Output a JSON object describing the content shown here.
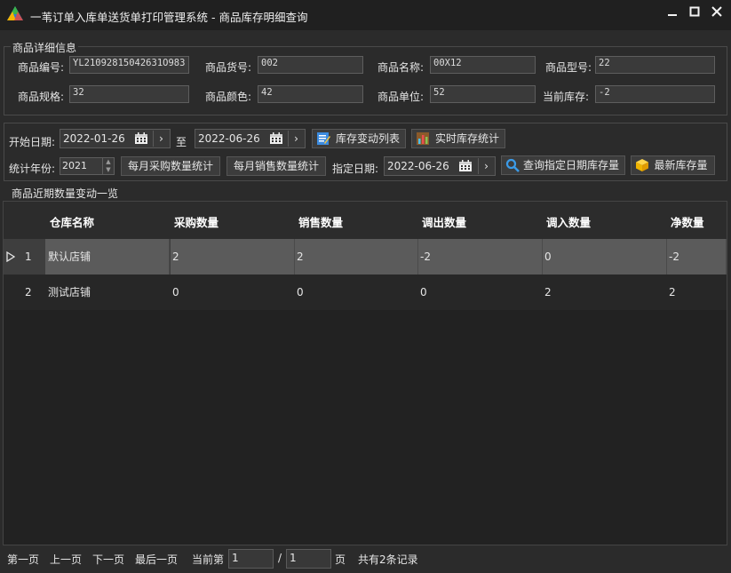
{
  "window": {
    "title": "一苇订单入库单送货单打印管理系统 - 商品库存明细查询"
  },
  "detail": {
    "group_title": "商品详细信息",
    "fields": [
      {
        "label": "商品编号:",
        "value": "YL21092815042631O983"
      },
      {
        "label": "商品货号:",
        "value": "002"
      },
      {
        "label": "商品名称:",
        "value": "00X12"
      },
      {
        "label": "商品型号:",
        "value": "22"
      },
      {
        "label": "商品规格:",
        "value": "32"
      },
      {
        "label": "商品颜色:",
        "value": "42"
      },
      {
        "label": "商品单位:",
        "value": "52"
      },
      {
        "label": "当前库存:",
        "value": "-2"
      }
    ]
  },
  "query": {
    "start_label": "开始日期:",
    "start_date": "2022-01-26",
    "to_label": "至",
    "end_date": "2022-06-26",
    "btn_change_list": "库存变动列表",
    "btn_realtime": "实时库存统计",
    "year_label": "统计年份:",
    "year_value": "2021",
    "btn_monthly_purchase": "每月采购数量统计",
    "btn_monthly_sales": "每月销售数量统计",
    "specified_label": "指定日期:",
    "specified_date": "2022-06-26",
    "btn_query_specified": "查询指定日期库存量",
    "btn_latest": "最新库存量"
  },
  "grid": {
    "group_title": "商品近期数量变动一览",
    "columns": [
      "仓库名称",
      "采购数量",
      "销售数量",
      "调出数量",
      "调入数量",
      "净数量"
    ],
    "rows": [
      {
        "index": "1",
        "cells": [
          "默认店铺",
          "2",
          "2",
          "-2",
          "0",
          "-2"
        ]
      },
      {
        "index": "2",
        "cells": [
          "测试店铺",
          "0",
          "0",
          "0",
          "2",
          "2"
        ]
      }
    ]
  },
  "pager": {
    "first": "第一页",
    "prev": "上一页",
    "next": "下一页",
    "last": "最后一页",
    "current_label": "当前第",
    "current_page": "1",
    "slash": "/",
    "total_pages": "1",
    "page_unit": "页",
    "total_records": "共有2条记录"
  },
  "icons": {
    "app_logo": "triangle-logo-icon",
    "calendar": "calendar-icon",
    "list": "edit-list-icon",
    "chart": "bar-chart-icon",
    "search": "magnifier-icon",
    "box": "package-icon"
  }
}
